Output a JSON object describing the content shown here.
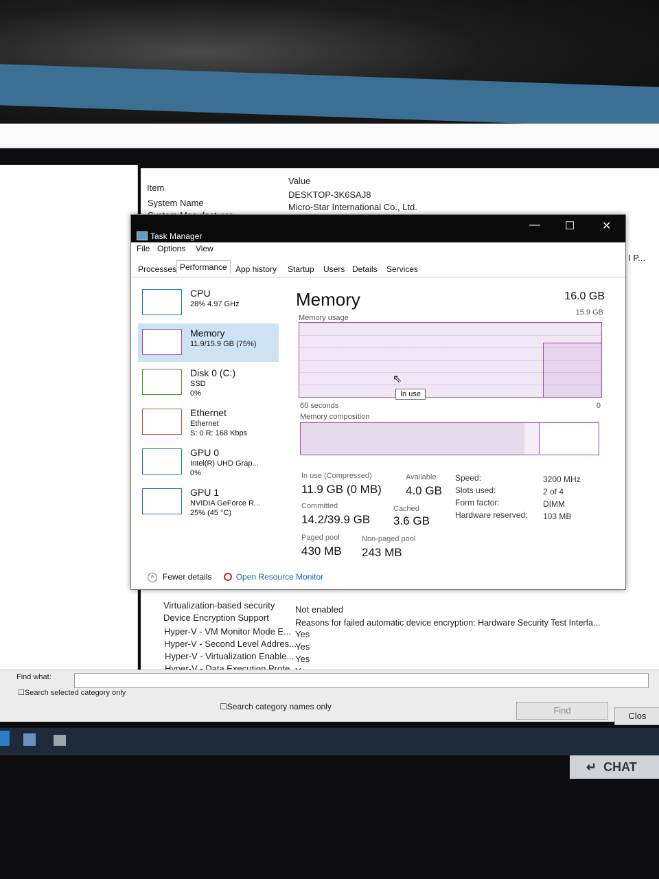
{
  "sysinfo": {
    "headers": {
      "item": "Item",
      "value": "Value"
    },
    "top_rows": [
      {
        "item": "System Name",
        "value": "DESKTOP-3K6SAJ8"
      },
      {
        "item": "System Manufacturer",
        "value": "Micro-Star International Co., Ltd."
      }
    ],
    "right_edge_text": "I P...",
    "bottom_rows": [
      {
        "item": "Virtualization-based security",
        "value": "Not enabled"
      },
      {
        "item": "Device Encryption Support",
        "value": "Reasons for failed automatic device encryption: Hardware Security Test Interfa..."
      },
      {
        "item": "Hyper-V - VM Monitor Mode E...",
        "value": "Yes"
      },
      {
        "item": "Hyper-V - Second Level Addres...",
        "value": "Yes"
      },
      {
        "item": "Hyper-V - Virtualization Enable...",
        "value": "Yes"
      },
      {
        "item": "Hyper-V - Data Execution Prote...",
        "value": "Yes"
      }
    ],
    "find": {
      "label": "Find what:",
      "search_selected": "Search selected category only",
      "search_names": "Search category names only",
      "find_button": "Find",
      "close_button": "Clos"
    }
  },
  "taskmanager": {
    "title": "Task Manager",
    "window_buttons": {
      "minimize": "—",
      "maximize": "☐",
      "close": "✕"
    },
    "menu": [
      "File",
      "Options",
      "View"
    ],
    "tabs": [
      "Processes",
      "Performance",
      "App history",
      "Startup",
      "Users",
      "Details",
      "Services"
    ],
    "active_tab": "Performance",
    "sidebar": [
      {
        "name": "CPU",
        "line1": "28% 4.97 GHz",
        "line2": "",
        "color": "#1a74c6"
      },
      {
        "name": "Memory",
        "line1": "11.9/15.9 GB (75%)",
        "line2": "",
        "color": "#9b4fb2"
      },
      {
        "name": "Disk 0 (C:)",
        "line1": "SSD",
        "line2": "0%",
        "color": "#4c9a2a"
      },
      {
        "name": "Ethernet",
        "line1": "Ethernet",
        "line2": "S: 0 R: 168 Kbps",
        "color": "#c8502c"
      },
      {
        "name": "GPU 0",
        "line1": "Intel(R) UHD Grap...",
        "line2": "0%",
        "color": "#1a74c6"
      },
      {
        "name": "GPU 1",
        "line1": "NVIDIA GeForce R...",
        "line2": "25% (45 °C)",
        "color": "#1a74c6"
      }
    ],
    "memory": {
      "title": "Memory",
      "total": "16.0 GB",
      "usage_label": "Memory usage",
      "usage_max": "15.9 GB",
      "graph_left": "60 seconds",
      "graph_right": "0",
      "tooltip": "In use",
      "composition_label": "Memory composition",
      "composition": {
        "in_use_fraction": 0.75,
        "modified_fraction": 0.05
      },
      "stats": {
        "in_use_label": "In use (Compressed)",
        "in_use_value": "11.9 GB (0 MB)",
        "available_label": "Available",
        "available_value": "4.0 GB",
        "committed_label": "Committed",
        "committed_value": "14.2/39.9 GB",
        "cached_label": "Cached",
        "cached_value": "3.6 GB",
        "paged_label": "Paged pool",
        "paged_value": "430 MB",
        "nonpaged_label": "Non-paged pool",
        "nonpaged_value": "243 MB"
      },
      "specs": [
        {
          "k": "Speed:",
          "v": "3200 MHz"
        },
        {
          "k": "Slots used:",
          "v": "2 of 4"
        },
        {
          "k": "Form factor:",
          "v": "DIMM"
        },
        {
          "k": "Hardware reserved:",
          "v": "103 MB"
        }
      ]
    },
    "footer": {
      "fewer_details": "Fewer details",
      "resource_monitor": "Open Resource Monitor"
    }
  },
  "chat_badge": "CHAT"
}
